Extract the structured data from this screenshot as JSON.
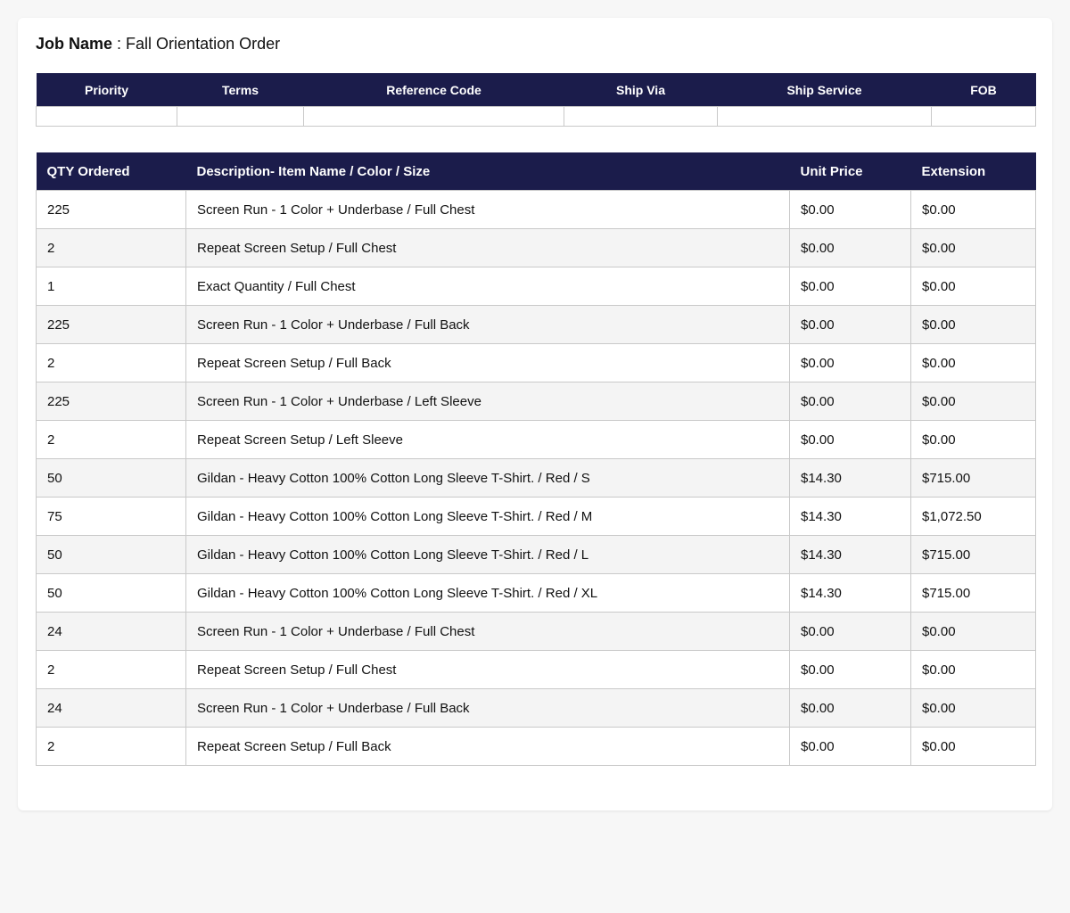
{
  "job": {
    "label": "Job Name",
    "separator": " : ",
    "value": "Fall Orientation Order"
  },
  "shipping": {
    "headers": [
      "Priority",
      "Terms",
      "Reference Code",
      "Ship Via",
      "Ship Service",
      "FOB"
    ],
    "values": [
      "",
      "",
      "",
      "",
      "",
      ""
    ]
  },
  "items": {
    "headers": [
      "QTY Ordered",
      "Description- Item Name / Color / Size",
      "Unit Price",
      "Extension"
    ],
    "rows": [
      {
        "qty": "225",
        "description": "Screen Run - 1 Color + Underbase / Full Chest",
        "unit_price": "$0.00",
        "extension": "$0.00"
      },
      {
        "qty": "2",
        "description": "Repeat Screen Setup / Full Chest",
        "unit_price": "$0.00",
        "extension": "$0.00"
      },
      {
        "qty": "1",
        "description": "Exact Quantity / Full Chest",
        "unit_price": "$0.00",
        "extension": "$0.00"
      },
      {
        "qty": "225",
        "description": "Screen Run - 1 Color + Underbase / Full Back",
        "unit_price": "$0.00",
        "extension": "$0.00"
      },
      {
        "qty": "2",
        "description": "Repeat Screen Setup / Full Back",
        "unit_price": "$0.00",
        "extension": "$0.00"
      },
      {
        "qty": "225",
        "description": "Screen Run - 1 Color + Underbase / Left Sleeve",
        "unit_price": "$0.00",
        "extension": "$0.00"
      },
      {
        "qty": "2",
        "description": "Repeat Screen Setup / Left Sleeve",
        "unit_price": "$0.00",
        "extension": "$0.00"
      },
      {
        "qty": "50",
        "description": "Gildan - Heavy Cotton 100% Cotton Long Sleeve T-Shirt. / Red / S",
        "unit_price": "$14.30",
        "extension": "$715.00"
      },
      {
        "qty": "75",
        "description": "Gildan - Heavy Cotton 100% Cotton Long Sleeve T-Shirt. / Red / M",
        "unit_price": "$14.30",
        "extension": "$1,072.50"
      },
      {
        "qty": "50",
        "description": "Gildan - Heavy Cotton 100% Cotton Long Sleeve T-Shirt. / Red / L",
        "unit_price": "$14.30",
        "extension": "$715.00"
      },
      {
        "qty": "50",
        "description": "Gildan - Heavy Cotton 100% Cotton Long Sleeve T-Shirt. / Red / XL",
        "unit_price": "$14.30",
        "extension": "$715.00"
      },
      {
        "qty": "24",
        "description": "Screen Run - 1 Color + Underbase / Full Chest",
        "unit_price": "$0.00",
        "extension": "$0.00"
      },
      {
        "qty": "2",
        "description": "Repeat Screen Setup / Full Chest",
        "unit_price": "$0.00",
        "extension": "$0.00"
      },
      {
        "qty": "24",
        "description": "Screen Run - 1 Color + Underbase / Full Back",
        "unit_price": "$0.00",
        "extension": "$0.00"
      },
      {
        "qty": "2",
        "description": "Repeat Screen Setup / Full Back",
        "unit_price": "$0.00",
        "extension": "$0.00"
      }
    ]
  },
  "colors": {
    "header_bg": "#1b1c4b",
    "stripe_bg": "#f4f4f4"
  }
}
